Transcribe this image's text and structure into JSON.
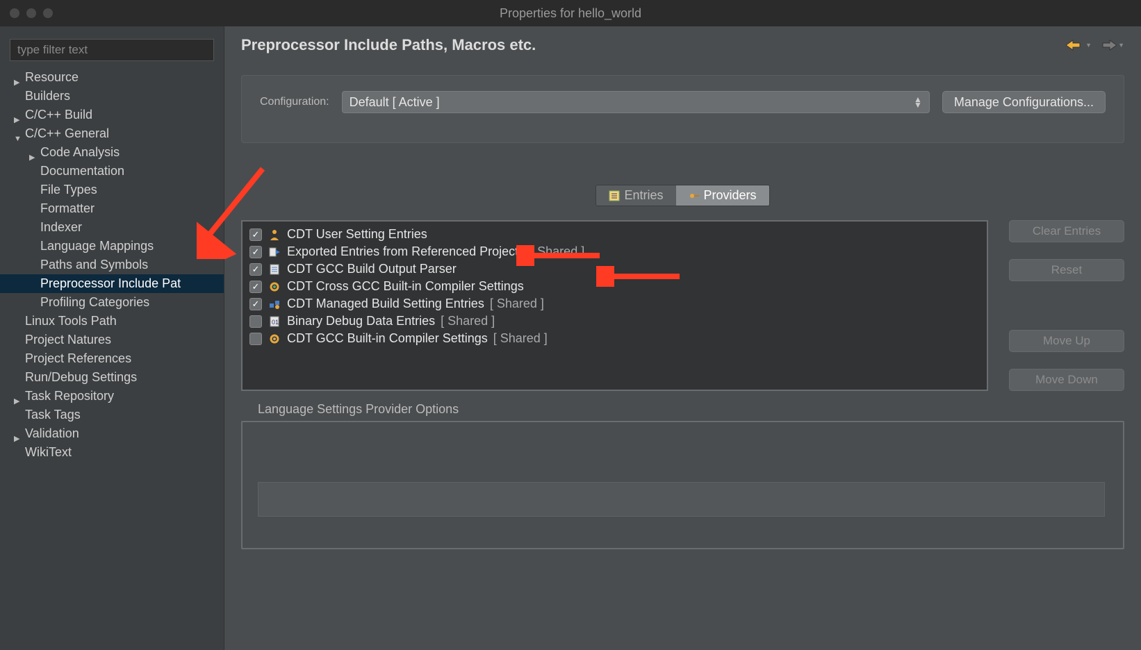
{
  "window": {
    "title": "Properties for hello_world"
  },
  "sidebar": {
    "filter_placeholder": "type filter text",
    "items": [
      {
        "label": "Resource",
        "indent": 0,
        "arrow": "collapsed"
      },
      {
        "label": "Builders",
        "indent": 0,
        "arrow": "none"
      },
      {
        "label": "C/C++ Build",
        "indent": 0,
        "arrow": "collapsed"
      },
      {
        "label": "C/C++ General",
        "indent": 0,
        "arrow": "expanded"
      },
      {
        "label": "Code Analysis",
        "indent": 1,
        "arrow": "collapsed"
      },
      {
        "label": "Documentation",
        "indent": 1,
        "arrow": "none"
      },
      {
        "label": "File Types",
        "indent": 1,
        "arrow": "none"
      },
      {
        "label": "Formatter",
        "indent": 1,
        "arrow": "none"
      },
      {
        "label": "Indexer",
        "indent": 1,
        "arrow": "none"
      },
      {
        "label": "Language Mappings",
        "indent": 1,
        "arrow": "none"
      },
      {
        "label": "Paths and Symbols",
        "indent": 1,
        "arrow": "none"
      },
      {
        "label": "Preprocessor Include Pat",
        "indent": 1,
        "arrow": "none",
        "selected": true
      },
      {
        "label": "Profiling Categories",
        "indent": 1,
        "arrow": "none"
      },
      {
        "label": "Linux Tools Path",
        "indent": 0,
        "arrow": "none"
      },
      {
        "label": "Project Natures",
        "indent": 0,
        "arrow": "none"
      },
      {
        "label": "Project References",
        "indent": 0,
        "arrow": "none"
      },
      {
        "label": "Run/Debug Settings",
        "indent": 0,
        "arrow": "none"
      },
      {
        "label": "Task Repository",
        "indent": 0,
        "arrow": "collapsed"
      },
      {
        "label": "Task Tags",
        "indent": 0,
        "arrow": "none"
      },
      {
        "label": "Validation",
        "indent": 0,
        "arrow": "collapsed"
      },
      {
        "label": "WikiText",
        "indent": 0,
        "arrow": "none"
      }
    ]
  },
  "page": {
    "title": "Preprocessor Include Paths, Macros etc."
  },
  "config": {
    "label": "Configuration:",
    "selected": "Default  [ Active ]",
    "manage": "Manage Configurations..."
  },
  "tabs": {
    "entries": "Entries",
    "providers": "Providers"
  },
  "providers": [
    {
      "checked": true,
      "icon": "person",
      "label": "CDT User Setting Entries",
      "shared": ""
    },
    {
      "checked": true,
      "icon": "export",
      "label": "Exported Entries from Referenced Projects",
      "shared": "  [ Shared ]"
    },
    {
      "checked": true,
      "icon": "file",
      "label": "CDT GCC Build Output Parser",
      "shared": ""
    },
    {
      "checked": true,
      "icon": "gear",
      "label": "CDT Cross GCC Built-in Compiler Settings",
      "shared": ""
    },
    {
      "checked": true,
      "icon": "managed",
      "label": "CDT Managed Build Setting Entries",
      "shared": "  [ Shared ]"
    },
    {
      "checked": false,
      "icon": "binary",
      "label": "Binary Debug Data Entries",
      "shared": "  [ Shared ]"
    },
    {
      "checked": false,
      "icon": "gear2",
      "label": "CDT GCC Built-in Compiler Settings",
      "shared": "  [ Shared ]"
    }
  ],
  "buttons": {
    "clear": "Clear Entries",
    "reset": "Reset",
    "moveup": "Move Up",
    "movedown": "Move Down"
  },
  "options": {
    "label": "Language Settings Provider Options"
  }
}
